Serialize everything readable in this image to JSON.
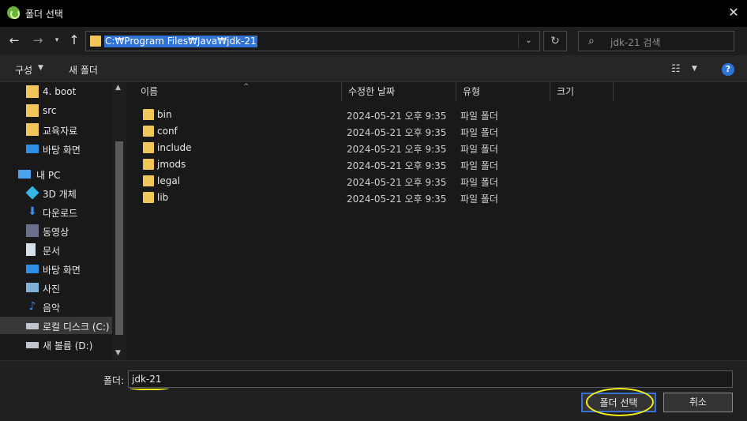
{
  "window": {
    "title": "폴더 선택",
    "close_glyph": "✕"
  },
  "address": {
    "path": "C:₩Program Files₩Java₩jdk-21",
    "search_placeholder": "jdk-21 검색"
  },
  "toolbar": {
    "organize_label": "구성",
    "new_folder_label": "새 폴더"
  },
  "nav_pane": {
    "items": [
      {
        "label": "4. boot",
        "icon": "folder-icon",
        "level": 1
      },
      {
        "label": "src",
        "icon": "folder-icon",
        "level": 1
      },
      {
        "label": "교육자료",
        "icon": "folder-icon",
        "level": 1
      },
      {
        "label": "바탕 화면",
        "icon": "desktop-icon",
        "level": 1
      },
      {
        "label": "내 PC",
        "icon": "computer-icon",
        "level": 0
      },
      {
        "label": "3D 개체",
        "icon": "cube-icon",
        "level": 1
      },
      {
        "label": "다운로드",
        "icon": "download-icon",
        "level": 1
      },
      {
        "label": "동영상",
        "icon": "video-icon",
        "level": 1
      },
      {
        "label": "문서",
        "icon": "document-icon",
        "level": 1
      },
      {
        "label": "바탕 화면",
        "icon": "desktop-icon",
        "level": 1
      },
      {
        "label": "사진",
        "icon": "picture-icon",
        "level": 1
      },
      {
        "label": "음악",
        "icon": "music-icon",
        "level": 1
      },
      {
        "label": "로컬 디스크 (C:)",
        "icon": "drive-icon",
        "level": 1,
        "selected": true
      },
      {
        "label": "새 볼륨 (D:)",
        "icon": "drive-icon",
        "level": 1
      }
    ]
  },
  "columns": {
    "name": "이름",
    "date": "수정한 날짜",
    "type": "유형",
    "size": "크기"
  },
  "files": [
    {
      "name": "bin",
      "date": "2024-05-21 오후 9:35",
      "type": "파일 폴더"
    },
    {
      "name": "conf",
      "date": "2024-05-21 오후 9:35",
      "type": "파일 폴더"
    },
    {
      "name": "include",
      "date": "2024-05-21 오후 9:35",
      "type": "파일 폴더"
    },
    {
      "name": "jmods",
      "date": "2024-05-21 오후 9:35",
      "type": "파일 폴더"
    },
    {
      "name": "legal",
      "date": "2024-05-21 오후 9:35",
      "type": "파일 폴더"
    },
    {
      "name": "lib",
      "date": "2024-05-21 오후 9:35",
      "type": "파일 폴더"
    }
  ],
  "footer": {
    "folder_label": "폴더:",
    "folder_value": "jdk-21",
    "select_button": "폴더 선택",
    "cancel_button": "취소"
  },
  "colors": {
    "accent": "#2f73d6",
    "folder": "#f1c75a",
    "annotation": "#f5ef17"
  }
}
